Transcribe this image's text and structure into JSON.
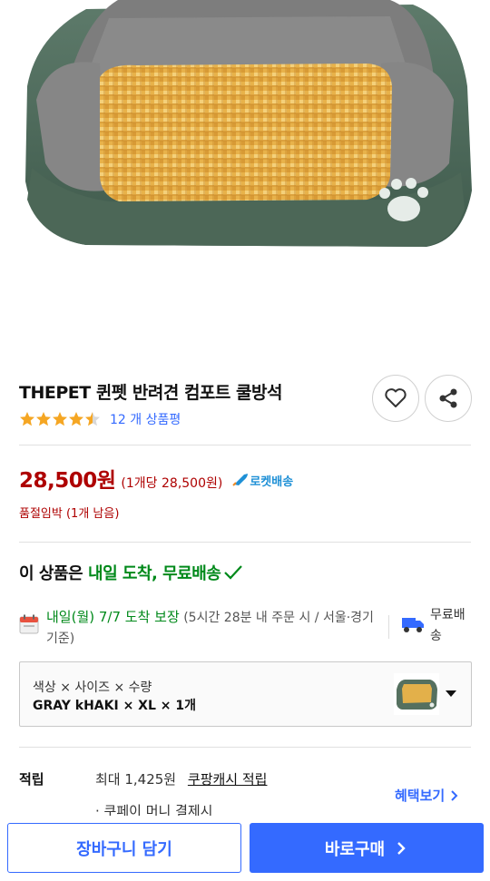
{
  "product": {
    "image_name": "pet-bed-product-image",
    "title": "THEPET 퀸펫 반려견 컴포트 쿨방석",
    "rating_stars": 4.5,
    "rating_count": "12 개 상품평"
  },
  "price": {
    "amount": "28,500원",
    "unit_price": "(1개당 28,500원)",
    "rocket_label": "로켓배송",
    "stock_status": "품절임박 (1개 남음)"
  },
  "arrival": {
    "prefix": "이 상품은",
    "highlight": "내일 도착, 무료배송"
  },
  "delivery": {
    "date": "내일(월) 7/7 도착 보장",
    "condition": "(5시간 28분 내 주문 시 / 서울·경기 기준)",
    "free_shipping": "무료배송"
  },
  "option": {
    "label": "색상 × 사이즈 × 수량",
    "value": "GRAY kHAKI × XL × 1개"
  },
  "reward": {
    "label": "적립",
    "max_text": "최대 1,425원",
    "cash_link": "쿠팡캐시 적립",
    "benefit_link": "혜택보기",
    "cut_line": "· 쿠페이 머니 결제시"
  },
  "actions": {
    "cart": "장바구니 담기",
    "buy": "바로구매"
  },
  "colors": {
    "price_red": "#ae0000",
    "link_blue": "#346aff",
    "arrival_green": "#00891a",
    "star_orange": "#f5a623"
  }
}
